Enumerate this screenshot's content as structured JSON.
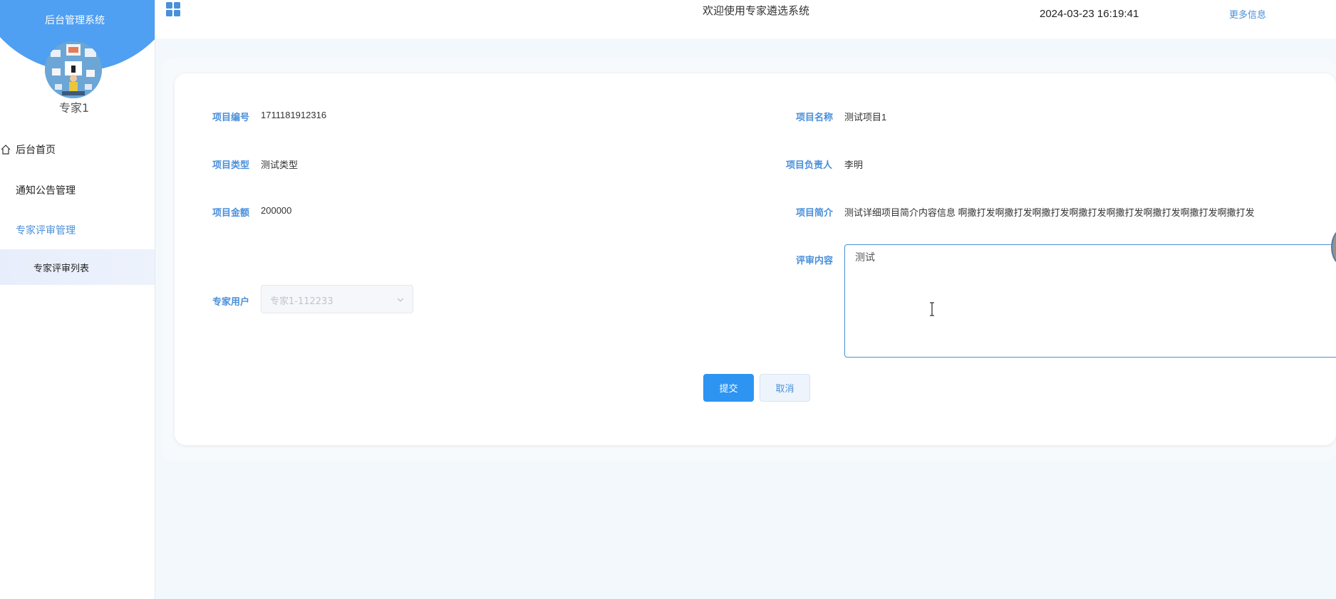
{
  "sidebar": {
    "system_title": "后台管理系统",
    "user_name": "专家1",
    "menu": {
      "home": "后台首页",
      "notice": "通知公告管理",
      "review": "专家评审管理",
      "review_list": "专家评审列表"
    }
  },
  "topbar": {
    "welcome": "欢迎使用专家遴选系统",
    "datetime": "2024-03-23 16:19:41",
    "more_info": "更多信息"
  },
  "form": {
    "project_no_label": "项目编号",
    "project_no": "1711181912316",
    "project_name_label": "项目名称",
    "project_name": "测试项目1",
    "project_type_label": "项目类型",
    "project_type": "测试类型",
    "project_leader_label": "项目负责人",
    "project_leader": "李明",
    "project_amount_label": "项目金额",
    "project_amount": "200000",
    "project_intro_label": "项目简介",
    "project_intro": "测试详细项目简介内容信息 啊撒打发啊撒打发啊撒打发啊撒打发啊撒打发啊撒打发啊撒打发啊撒打发",
    "expert_user_label": "专家用户",
    "expert_user": "专家1-112233",
    "review_content_label": "评审内容",
    "review_content": "测试"
  },
  "buttons": {
    "submit": "提交",
    "cancel": "取消"
  },
  "colors": {
    "accent": "#4a8fd9",
    "primary_button": "#2d94f2",
    "sidebar_header": "#4f9ff2"
  }
}
